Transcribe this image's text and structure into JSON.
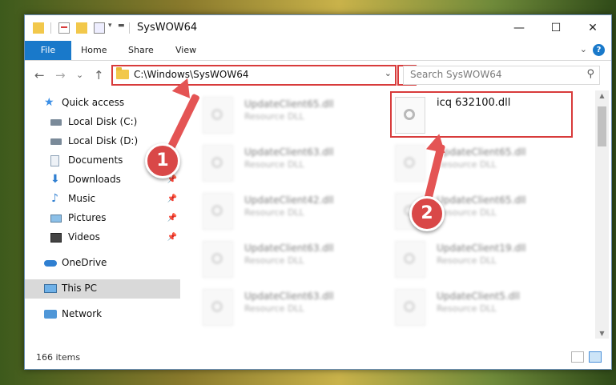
{
  "window": {
    "title": "SysWOW64"
  },
  "window_controls": {
    "minimize": "—",
    "maximize": "☐",
    "close": "✕"
  },
  "ribbon": {
    "file": "File",
    "tabs": [
      "Home",
      "Share",
      "View"
    ],
    "help": "?"
  },
  "navigation": {
    "back": "←",
    "forward": "→",
    "recent": "⌄",
    "up": "↑",
    "address": "C:\\Windows\\SysWOW64",
    "search_placeholder": "Search SysWOW64"
  },
  "sidebar": {
    "items": [
      {
        "label": "Quick access",
        "icon": "star-icon",
        "pinned": false
      },
      {
        "label": "Local Disk (C:)",
        "icon": "drive-icon",
        "pinned": false
      },
      {
        "label": "Local Disk (D:)",
        "icon": "drive-icon",
        "pinned": false
      },
      {
        "label": "Documents",
        "icon": "documents-icon",
        "pinned": true
      },
      {
        "label": "Downloads",
        "icon": "download-icon",
        "pinned": true
      },
      {
        "label": "Music",
        "icon": "music-icon",
        "pinned": true
      },
      {
        "label": "Pictures",
        "icon": "pictures-icon",
        "pinned": true
      },
      {
        "label": "Videos",
        "icon": "video-icon",
        "pinned": true
      },
      {
        "label": "OneDrive",
        "icon": "cloud-icon",
        "pinned": false
      },
      {
        "label": "This PC",
        "icon": "computer-icon",
        "pinned": false,
        "selected": true
      },
      {
        "label": "Network",
        "icon": "network-icon",
        "pinned": false
      }
    ],
    "pin_glyph": "📌"
  },
  "files": {
    "left": [
      {
        "name": "UpdateClient65.dll",
        "type": "Resource DLL"
      },
      {
        "name": "UpdateClient63.dll",
        "type": "Resource DLL"
      },
      {
        "name": "UpdateClient42.dll",
        "type": "Resource DLL"
      },
      {
        "name": "UpdateClient63.dll",
        "type": "Resource DLL"
      },
      {
        "name": "UpdateClient63.dll",
        "type": "Resource DLL"
      }
    ],
    "right": [
      {
        "name": "icq 632100.dll",
        "type": ""
      },
      {
        "name": "UpdateClient65.dll",
        "type": "Resource DLL"
      },
      {
        "name": "UpdateClient65.dll",
        "type": "Resource DLL"
      },
      {
        "name": "UpdateClient19.dll",
        "type": "Resource DLL"
      },
      {
        "name": "UpdateClient5.dll",
        "type": "Resource DLL"
      }
    ]
  },
  "status": {
    "count": "166 items"
  },
  "annotations": {
    "step1": "1",
    "step2": "2"
  },
  "colors": {
    "accent": "#1979ca",
    "annotation": "#d83b3b",
    "arrow": "#e45454"
  }
}
